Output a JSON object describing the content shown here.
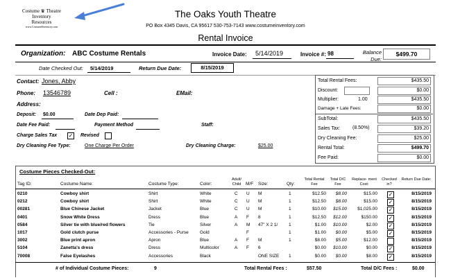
{
  "logo": {
    "line1": "Costume",
    "line2": "Theatre",
    "line3": "Inventory",
    "line4": "Resources",
    "url": "www.CostumeInventory.com"
  },
  "header": {
    "org_name": "The Oaks Youth Theatre",
    "address": "PO Box 4345 Davis, CA  95617  530-753-7143   www.costumeinventory.com",
    "doc_title": "Rental Invoice"
  },
  "org": {
    "label": "Organization:",
    "value": "ABC Costume Rentals",
    "invoice_date_label": "Invoice Date:",
    "invoice_date": "5/14/2019",
    "invoice_no_label": "Invoice #:",
    "invoice_no": "98",
    "balance_label": "Balance Due:",
    "balance": "$499.70"
  },
  "dates": {
    "checked_out_label": "Date Checked Out:",
    "checked_out": "5/14/2019",
    "return_due_label": "Return Due Date:",
    "return_due": "8/15/2019"
  },
  "contact": {
    "contact_label": "Contact:",
    "contact": "Jones, Abby",
    "phone_label": "Phone:",
    "phone": "13546789",
    "cell_label": "Cell :",
    "email_label": "EMail:",
    "address_label": "Address:",
    "deposit_label": "Deposit:",
    "deposit": "$0.00",
    "dep_paid_label": "Date Dep Paid:",
    "fee_paid_label": "Date Fee Paid:",
    "payment_label": "Payment Method",
    "staff_label": "Staff:",
    "tax_label": "Charge Sales Tax",
    "tax_checked": true,
    "revised_label": "Revised",
    "revised_checked": false,
    "dry_type_label": "Dry Cleaning Fee Type:",
    "dry_type": "One Charge Per Order",
    "dry_charge_label": "Dry Cleaning Charge:",
    "dry_charge": "$25.00"
  },
  "totals": {
    "rental_fees_label": "Total Rental Fees:",
    "rental_fees": "$435.50",
    "discount_label": "Discount:",
    "discount": "$0.00",
    "multiplier_label": "Multiplier:",
    "multiplier": "1.00",
    "multiplier_total": "$435.50",
    "damage_label": "Damage + Late Fees:",
    "damage": "$0.00",
    "subtotal_label": "SubTotal:",
    "subtotal": "$435.50",
    "sales_tax_label": "Sales Tax:",
    "sales_tax_rate": "(8.50%)",
    "sales_tax": "$39.20",
    "dry_fee_label": "Dry Cleaning Fee:",
    "dry_fee": "$25.00",
    "rental_total_label": "Rental Total:",
    "rental_total": "$499.70",
    "fee_paid_label": "Fee Paid:",
    "fee_paid": "$0.00"
  },
  "pieces": {
    "section_title": "Costume Pieces Checked-Out:",
    "columns": {
      "tag": "Tag ID:",
      "name": "Costume Name:",
      "type": "Costume Type:",
      "color": "Color:",
      "adult": "Adult/ Child",
      "mf": "M/F",
      "size": "Size:",
      "qty": "Qty:",
      "rental": "Total Rental Fee",
      "dc": "Total D/C Fee",
      "replace": "Replace- ment Cost:",
      "checked": "Checked in?",
      "due": "Return Due Date:"
    },
    "rows": [
      {
        "tag": "0210",
        "name": "Cowboy shirt",
        "type": "Shirt",
        "color": "White",
        "ac": "C",
        "mf": "U",
        "size": "M",
        "qty": "1",
        "rental": "$12.50",
        "dc": "$8.00",
        "replace": "$15.00",
        "checked": true,
        "due": "8/15/2019"
      },
      {
        "tag": "0212",
        "name": "Cowboy shirt",
        "type": "Shirt",
        "color": "White",
        "ac": "C",
        "mf": "U",
        "size": "M",
        "qty": "1",
        "rental": "$12.50",
        "dc": "$8.00",
        "replace": "$15.00",
        "checked": true,
        "due": "8/15/2019"
      },
      {
        "tag": "00281",
        "name": "Blue Chinese Jacket",
        "type": "Jacket",
        "color": "Blue",
        "ac": "C",
        "mf": "U",
        "size": "M",
        "qty": "1",
        "rental": "$10.00",
        "dc": "$15.00",
        "replace": "$1,025.00",
        "checked": true,
        "due": "8/15/2019"
      },
      {
        "tag": "0401",
        "name": "Snow White Dress",
        "type": "Dress",
        "color": "Blue",
        "ac": "A",
        "mf": "F",
        "size": "8",
        "qty": "1",
        "rental": "$12.50",
        "dc": "$12.00",
        "replace": "$150.00",
        "checked": true,
        "due": "8/15/2019"
      },
      {
        "tag": "0584",
        "name": "Silver tie with blue/red flowers",
        "type": "Tie",
        "color": "Silver",
        "ac": "A",
        "mf": "M",
        "size": "47\" X 2 1/",
        "qty": "1",
        "rental": "$1.00",
        "dc": "$10.00",
        "replace": "$2.00",
        "checked": true,
        "due": "8/15/2019"
      },
      {
        "tag": "1017",
        "name": "Gold clutch purse",
        "type": "Accessories - Purse",
        "color": "Gold",
        "ac": "",
        "mf": "F",
        "size": "",
        "qty": "1",
        "rental": "$1.00",
        "dc": "$0.00",
        "replace": "$5.00",
        "checked": true,
        "due": "8/15/2019"
      },
      {
        "tag": "3002",
        "name": "Blue print apron",
        "type": "Apron",
        "color": "Blue",
        "ac": "A",
        "mf": "F",
        "size": "M",
        "qty": "1",
        "rental": "$8.00",
        "dc": "$5.00",
        "replace": "$12.00",
        "checked": false,
        "due": "8/15/2019"
      },
      {
        "tag": "5104",
        "name": "Zanetta's dress",
        "type": "Dress",
        "color": "Multicolor",
        "ac": "A",
        "mf": "F",
        "size": "6",
        "qty": "",
        "rental": "$0.00",
        "dc": "$10.00",
        "replace": "$0.00",
        "checked": true,
        "due": "8/15/2019"
      },
      {
        "tag": "70008",
        "name": "False Eyelashes",
        "type": "Accessories",
        "color": "Black",
        "ac": "",
        "mf": "",
        "size": "ONE SIZE",
        "qty": "1",
        "rental": "$0.00",
        "dc": "$0.00",
        "replace": "$8.00",
        "checked": true,
        "due": "8/15/2019"
      }
    ],
    "footer": {
      "count_label": "# of Individual Costume Pieces:",
      "count": "9",
      "total_rental_label": "Total Rental Fees :",
      "total_rental": "$57.50",
      "total_dc_label": "Total D/C Fees :",
      "total_dc": "$0.00"
    }
  }
}
